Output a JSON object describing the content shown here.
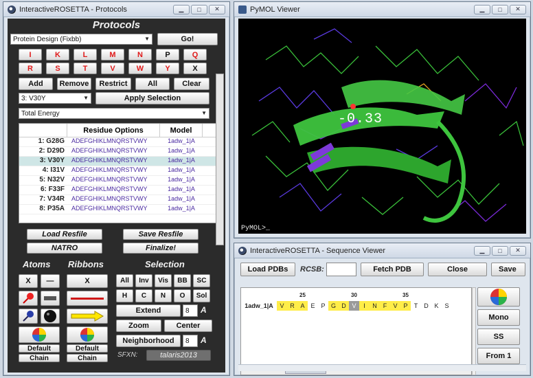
{
  "protocols_window": {
    "title": "InteractiveROSETTA - Protocols",
    "heading": "Protocols",
    "protocol_select": "Protein Design (Fixbb)",
    "go_label": "Go!",
    "aa_buttons": [
      "I",
      "K",
      "L",
      "M",
      "N",
      "P",
      "Q",
      "R",
      "S",
      "T",
      "V",
      "W",
      "Y",
      "X"
    ],
    "add_label": "Add",
    "remove_label": "Remove",
    "restrict_label": "Restrict",
    "all_label": "All",
    "clear_label": "Clear",
    "position_select": "3: V30Y",
    "apply_selection_label": "Apply Selection",
    "energy_select": "Total Energy",
    "table": {
      "headers": [
        "Residue Options",
        "Model"
      ],
      "rows": [
        {
          "id": "1: G28G",
          "options": "ADEFGHIKLMNQRSTVWY",
          "model": "1adw_1|A"
        },
        {
          "id": "2: D29D",
          "options": "ADEFGHIKLMNQRSTVWY",
          "model": "1adw_1|A"
        },
        {
          "id": "3: V30Y",
          "options": "ADEFGHIKLMNQRSTVWY",
          "model": "1adw_1|A"
        },
        {
          "id": "4: I31V",
          "options": "ADEFGHIKLMNQRSTVWY",
          "model": "1adw_1|A"
        },
        {
          "id": "5: N32V",
          "options": "ADEFGHIKLMNQRSTVWY",
          "model": "1adw_1|A"
        },
        {
          "id": "6: F33F",
          "options": "ADEFGHIKLMNQRSTVWY",
          "model": "1adw_1|A"
        },
        {
          "id": "7: V34R",
          "options": "ADEFGHIKLMNQRSTVWY",
          "model": "1adw_1|A"
        },
        {
          "id": "8: P35A",
          "options": "ADEFGHIKLMNQRSTVWY",
          "model": "1adw_1|A"
        }
      ]
    },
    "load_resfile_label": "Load Resfile",
    "save_resfile_label": "Save Resfile",
    "natro_label": "NATRO",
    "finalize_label": "Finalize!",
    "atoms_heading": "Atoms",
    "ribbons_heading": "Ribbons",
    "selection_heading": "Selection",
    "x_label": "X",
    "default_label": "Default",
    "chain_label": "Chain",
    "selection_buttons": [
      "All",
      "Inv",
      "Vis",
      "BB",
      "SC",
      "H",
      "C",
      "N",
      "O",
      "Sol"
    ],
    "extend_label": "Extend",
    "extend_value": "8",
    "zoom_label": "Zoom",
    "center_label": "Center",
    "neighborhood_label": "Neighborhood",
    "neighborhood_value": "8",
    "angstrom": "A",
    "sfxn_label": "SFXN:",
    "sfxn_value": "talaris2013"
  },
  "pymol_window": {
    "title": "PyMOL Viewer",
    "label": "-0.33",
    "prompt": "PyMOL>_"
  },
  "seq_window": {
    "title": "InteractiveROSETTA - Sequence Viewer",
    "load_pdbs_label": "Load PDBs",
    "rcsb_label": "RCSB:",
    "rcsb_value": "",
    "fetch_pdb_label": "Fetch PDB",
    "close_label": "Close",
    "save_label": "Save",
    "numbers": [
      "25",
      "30",
      "35"
    ],
    "chain_name": "1adw_1|A",
    "residues": [
      {
        "aa": "V",
        "style": "y"
      },
      {
        "aa": "R",
        "style": "y"
      },
      {
        "aa": "A",
        "style": "y"
      },
      {
        "aa": "E",
        "style": ""
      },
      {
        "aa": "P",
        "style": ""
      },
      {
        "aa": "G",
        "style": "y"
      },
      {
        "aa": "D",
        "style": "y"
      },
      {
        "aa": "V",
        "style": "g"
      },
      {
        "aa": "I",
        "style": "y"
      },
      {
        "aa": "N",
        "style": "y"
      },
      {
        "aa": "F",
        "style": "y"
      },
      {
        "aa": "V",
        "style": "y"
      },
      {
        "aa": "P",
        "style": "y"
      },
      {
        "aa": "T",
        "style": ""
      },
      {
        "aa": "D",
        "style": ""
      },
      {
        "aa": "K",
        "style": ""
      },
      {
        "aa": "S",
        "style": ""
      }
    ],
    "mono_label": "Mono",
    "ss_label": "SS",
    "from1_label": "From 1"
  }
}
